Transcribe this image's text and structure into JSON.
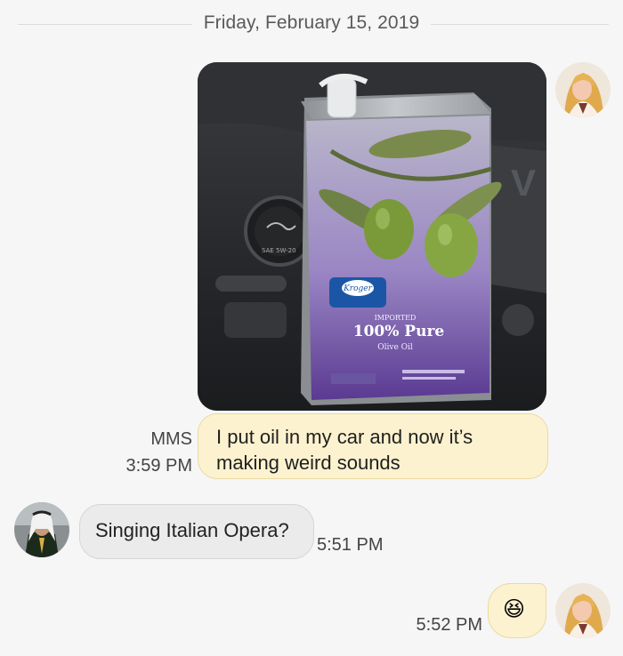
{
  "date_divider": "Friday, February 15, 2019",
  "messages": [
    {
      "direction": "out",
      "type": "mms-image",
      "image_text": {
        "brand": "Kroger",
        "line1": "IMPORTED",
        "line2": "100% Pure",
        "line3": "Olive Oil",
        "cap_text": "SAE 5W-20"
      }
    },
    {
      "direction": "out",
      "type": "text",
      "text_line1": "I put oil in my car and now it’s",
      "text_line2": "making weird sounds",
      "label": "MMS",
      "time": "3:59 PM"
    },
    {
      "direction": "in",
      "type": "text",
      "text": "Singing Italian Opera?",
      "time": "5:51 PM"
    },
    {
      "direction": "out",
      "type": "emoji",
      "text": "😆",
      "time": "5:52 PM"
    }
  ],
  "colors": {
    "outgoing_bubble": "#fcf2cf",
    "incoming_bubble": "#ebebeb",
    "background": "#f6f6f6"
  }
}
